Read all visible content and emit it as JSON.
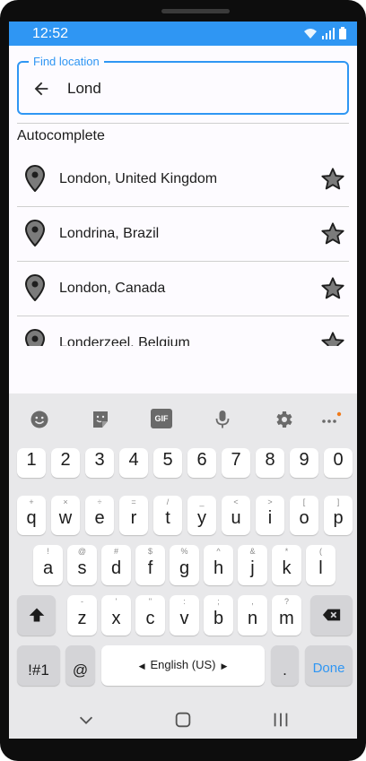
{
  "status_bar": {
    "time": "12:52",
    "background": "#2f96f3"
  },
  "search": {
    "label": "Find location",
    "value": "Lond",
    "back_icon": "arrow-left-icon"
  },
  "section": {
    "title": "Autocomplete"
  },
  "results": [
    {
      "label": "London, United Kingdom"
    },
    {
      "label": "Londrina, Brazil"
    },
    {
      "label": "London, Canada"
    },
    {
      "label": "Londerzeel, Belgium"
    }
  ],
  "keyboard": {
    "toolbar": [
      "emoji-icon",
      "sticker-icon",
      "gif-icon",
      "microphone-icon",
      "settings-icon",
      "more-icon"
    ],
    "gif_label": "GIF",
    "number_row": [
      "1",
      "2",
      "3",
      "4",
      "5",
      "6",
      "7",
      "8",
      "9",
      "0"
    ],
    "row1": [
      {
        "key": "q",
        "hint": "+"
      },
      {
        "key": "w",
        "hint": "×"
      },
      {
        "key": "e",
        "hint": "÷"
      },
      {
        "key": "r",
        "hint": "="
      },
      {
        "key": "t",
        "hint": "/"
      },
      {
        "key": "y",
        "hint": "_"
      },
      {
        "key": "u",
        "hint": "<"
      },
      {
        "key": "i",
        "hint": ">"
      },
      {
        "key": "o",
        "hint": "["
      },
      {
        "key": "p",
        "hint": "]"
      }
    ],
    "row2": [
      {
        "key": "a",
        "hint": "!"
      },
      {
        "key": "s",
        "hint": "@"
      },
      {
        "key": "d",
        "hint": "#"
      },
      {
        "key": "f",
        "hint": "$"
      },
      {
        "key": "g",
        "hint": "%"
      },
      {
        "key": "h",
        "hint": "^"
      },
      {
        "key": "j",
        "hint": "&"
      },
      {
        "key": "k",
        "hint": "*"
      },
      {
        "key": "l",
        "hint": "("
      }
    ],
    "row3": [
      {
        "key": "z",
        "hint": "-"
      },
      {
        "key": "x",
        "hint": "'"
      },
      {
        "key": "c",
        "hint": "\""
      },
      {
        "key": "v",
        "hint": ":"
      },
      {
        "key": "b",
        "hint": ";"
      },
      {
        "key": "n",
        "hint": ","
      },
      {
        "key": "m",
        "hint": "?"
      }
    ],
    "symbols_label": "!#1",
    "at_label": "@",
    "space_label": "English (US)",
    "period_label": ".",
    "done_label": "Done",
    "accent": "#2f96f3"
  }
}
